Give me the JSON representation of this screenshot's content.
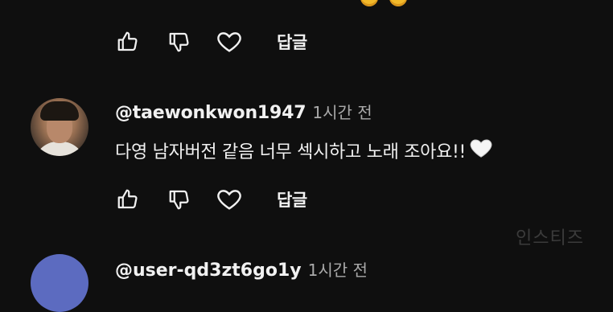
{
  "top_actions": {
    "reply_label": "답글"
  },
  "comment": {
    "handle": "@taewonkwon1947",
    "time": "1시간 전",
    "text": "다영 남자버전 같음 너무 섹시하고 노래 조아요!!",
    "emoji": "white-heart-icon"
  },
  "comment_actions": {
    "reply_label": "답글"
  },
  "next_comment": {
    "handle": "@user-qd3zt6go1y",
    "time": "1시간 전"
  },
  "watermark": "인스티즈",
  "colors": {
    "background": "#0f0f0f",
    "text": "#f1f1f1",
    "secondary_text": "#aaaaaa",
    "watermark": "#3b3b3b",
    "next_avatar": "#5c6bc0"
  }
}
